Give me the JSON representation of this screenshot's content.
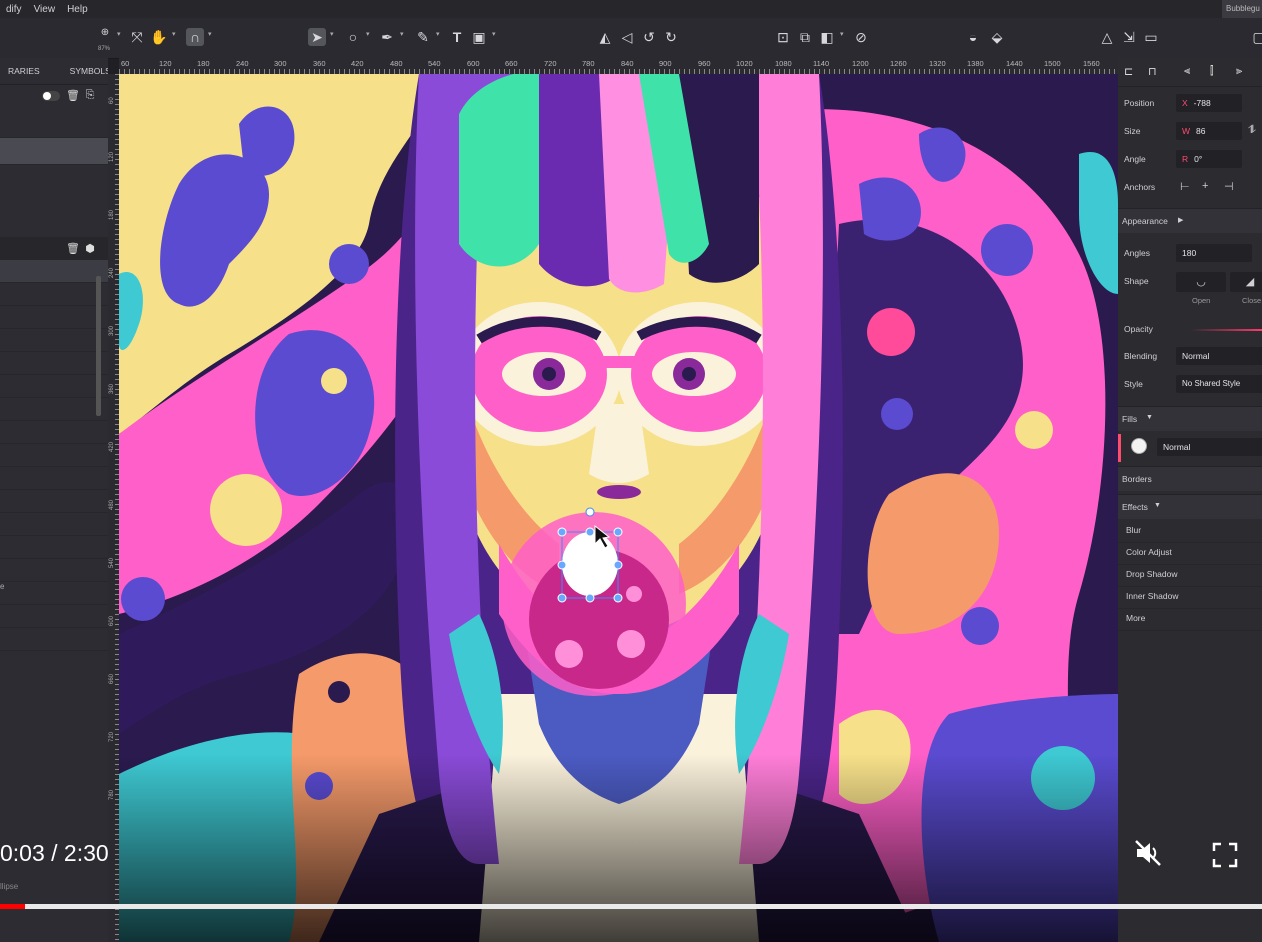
{
  "menu": {
    "items": [
      "dify",
      "View",
      "Help"
    ],
    "doc_tab": "Bubblegu"
  },
  "toolbar": {
    "zoom": "87%",
    "icons": [
      "zoom-icon",
      "fit-icon",
      "hand-icon",
      "magnet-icon",
      "pointer-icon",
      "ellipse-tool-icon",
      "pen-tool-icon",
      "pencil-tool-icon",
      "text-tool-icon",
      "image-tool-icon",
      "flip-icon",
      "mirror-icon",
      "rotate-left-icon",
      "rotate-right-icon",
      "group-icon",
      "ungroup-icon",
      "arrange-icon",
      "boolean-icon",
      "mask-icon",
      "lock-icon",
      "triangle-icon",
      "export-icon",
      "frame-icon"
    ]
  },
  "left_panel": {
    "tabs": [
      "RARIES",
      "SYMBOLS"
    ],
    "stray_char": "e",
    "bottom_label": "llipse"
  },
  "ruler": {
    "labels": [
      "60",
      "120",
      "180",
      "240",
      "300",
      "360",
      "420",
      "480",
      "540",
      "600",
      "660",
      "720",
      "780",
      "840",
      "900",
      "960",
      "1020",
      "1080",
      "1140",
      "1200",
      "1260",
      "1320",
      "1380",
      "1440",
      "1500",
      "1560"
    ],
    "vlabels": [
      "60",
      "120",
      "180",
      "240",
      "300",
      "360",
      "420",
      "480",
      "540",
      "600",
      "660",
      "720",
      "780"
    ]
  },
  "inspector": {
    "position": {
      "label": "Position",
      "prefix": "X",
      "value": "-788"
    },
    "size": {
      "label": "Size",
      "prefix": "W",
      "value": "86"
    },
    "angle": {
      "label": "Angle",
      "prefix": "R",
      "value": "0°"
    },
    "anchors": {
      "label": "Anchors"
    },
    "appearance": {
      "label": "Appearance"
    },
    "angles": {
      "label": "Angles",
      "value": "180"
    },
    "shape": {
      "label": "Shape",
      "open": "Open",
      "close": "Close"
    },
    "opacity": {
      "label": "Opacity"
    },
    "blending": {
      "label": "Blending",
      "value": "Normal"
    },
    "style": {
      "label": "Style",
      "value": "No Shared Style"
    },
    "fills": {
      "label": "Fills",
      "mode": "Normal"
    },
    "borders": {
      "label": "Borders"
    },
    "effects": {
      "label": "Effects",
      "items": [
        "Blur",
        "Color Adjust",
        "Drop Shadow",
        "Inner Shadow",
        "More"
      ]
    }
  },
  "video": {
    "time": "0:03 / 2:30",
    "progress": 0.02
  },
  "colors": {
    "accent": "#ff4b6e",
    "canvas_bg": "#2a1a4e",
    "pink": "#ff5fc8",
    "yellow": "#f6e08a",
    "teal": "#3ec9d3",
    "purple": "#5a4bd1",
    "orange": "#f59a6a"
  }
}
